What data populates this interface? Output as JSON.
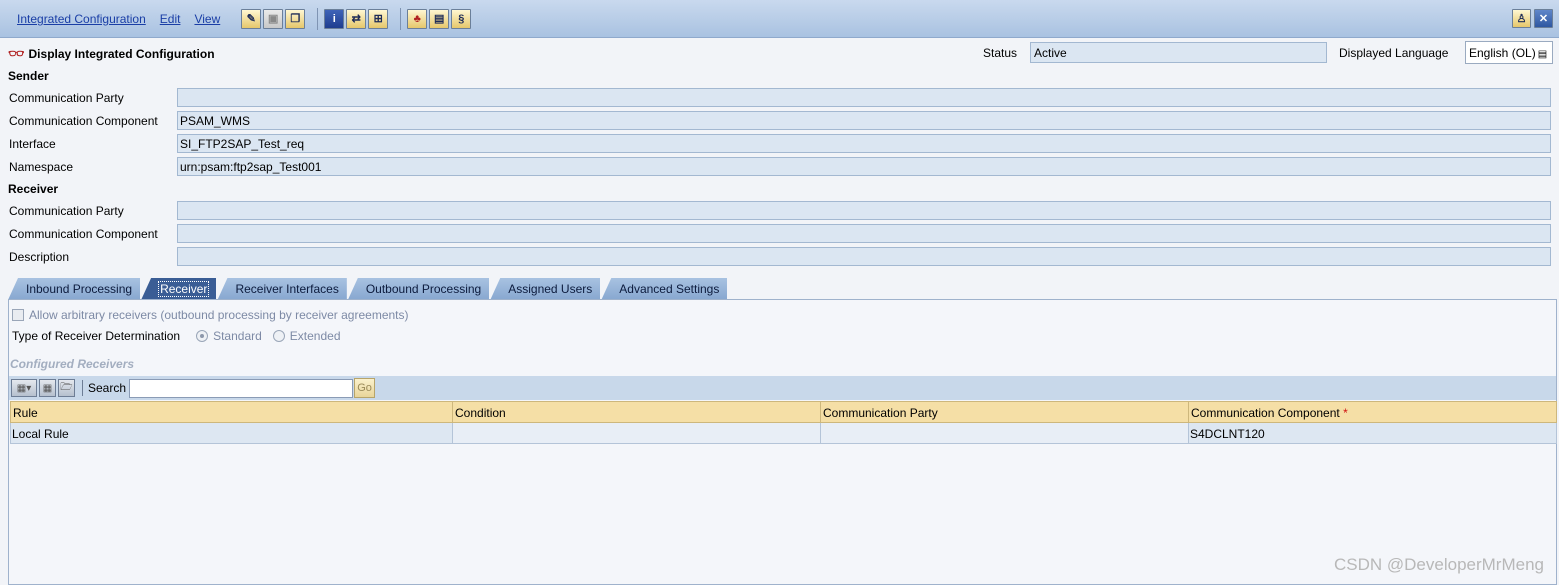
{
  "menu": {
    "items": [
      "Integrated Configuration",
      "Edit",
      "View"
    ]
  },
  "header": {
    "title": "Display Integrated Configuration",
    "status_label": "Status",
    "status_value": "Active",
    "language_label": "Displayed Language",
    "language_value": "English (OL)"
  },
  "sender": {
    "heading": "Sender",
    "fields": [
      {
        "label": "Communication Party",
        "value": ""
      },
      {
        "label": "Communication Component",
        "value": "PSAM_WMS"
      },
      {
        "label": "Interface",
        "value": "SI_FTP2SAP_Test_req"
      },
      {
        "label": "Namespace",
        "value": "urn:psam:ftp2sap_Test001"
      }
    ]
  },
  "receiver": {
    "heading": "Receiver",
    "fields": [
      {
        "label": "Communication Party",
        "value": ""
      },
      {
        "label": "Communication Component",
        "value": ""
      },
      {
        "label": "Description",
        "value": ""
      }
    ]
  },
  "tabs": [
    {
      "label": "Inbound Processing",
      "active": false
    },
    {
      "label": "Receiver",
      "active": true
    },
    {
      "label": "Receiver Interfaces",
      "active": false
    },
    {
      "label": "Outbound Processing",
      "active": false
    },
    {
      "label": "Assigned Users",
      "active": false
    },
    {
      "label": "Advanced Settings",
      "active": false
    }
  ],
  "receiver_tab": {
    "allow_arbitrary_label": "Allow arbitrary receivers (outbound processing by receiver agreements)",
    "determination_label": "Type of Receiver Determination",
    "options": [
      "Standard",
      "Extended"
    ],
    "selected_option": "Standard",
    "configured_title": "Configured Receivers",
    "search_label": "Search",
    "search_value": "",
    "go_label": "Go",
    "columns": [
      "Rule",
      "Condition",
      "Communication Party",
      "Communication Component"
    ],
    "required_marker": "*",
    "rows": [
      [
        "Local Rule",
        "",
        "",
        "S4DCLNT120"
      ]
    ]
  },
  "watermark": "CSDN @DeveloperMrMeng",
  "colors": {
    "menubar": "#a9c2e1",
    "active_tab": "#3a5d95",
    "grid_header": "#f5dfa6",
    "field_bg": "#dbe6f2"
  }
}
